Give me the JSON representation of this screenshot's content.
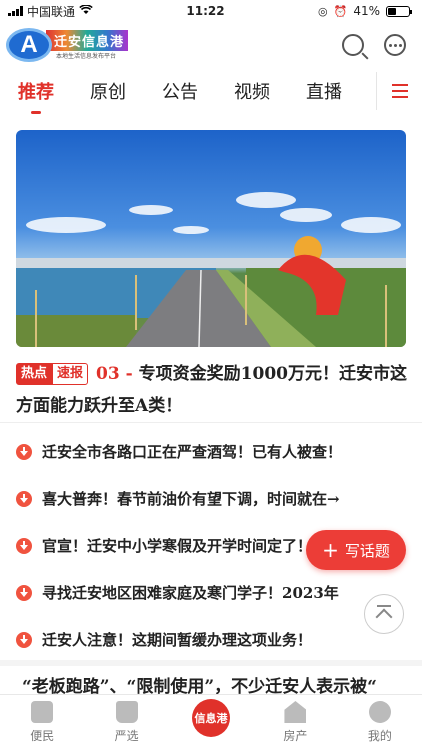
{
  "status_bar": {
    "carrier": "中国联通",
    "time": "11:22",
    "battery": "41%",
    "battery_level": 0.41
  },
  "header": {
    "logo_letter": "A",
    "logo_title": "迁安信息港",
    "logo_subtitle": "本地生活信息发布平台",
    "icons": [
      "search-icon",
      "chat-icon"
    ]
  },
  "tabs": [
    {
      "label": "推荐",
      "active": true
    },
    {
      "label": "原创",
      "active": false
    },
    {
      "label": "公告",
      "active": false
    },
    {
      "label": "视频",
      "active": false
    },
    {
      "label": "直播",
      "active": false
    }
  ],
  "headline": {
    "tag_hot": "热点",
    "tag_fast": "速报",
    "number": "03 -",
    "text": "专项资金奖励1000万元！迁安市这方面能力跃升至A类！"
  },
  "news": [
    "迁安全市各路口正在严查酒驾！已有人被查！",
    "喜大普奔！春节前油价有望下调，时间就在→",
    "官宣！迁安中小学寒假及开学时间定了！",
    "寻找迁安地区困难家庭及寒门学子！2023年",
    "迁安人注意！这期间暂缓办理这项业务！"
  ],
  "write_button": {
    "label": "写话题",
    "icon": "plus-icon"
  },
  "teaser": "“老板跑路”、“限制使用”，不少迁安人表示被“",
  "bottom_nav": {
    "items": [
      {
        "label": "便民",
        "icon": "convenience-icon"
      },
      {
        "label": "严选",
        "icon": "shopping-bag-icon"
      },
      {
        "label": "信息港",
        "icon": "home-center-icon"
      },
      {
        "label": "房产",
        "icon": "building-icon"
      },
      {
        "label": "我的",
        "icon": "avatar-icon"
      }
    ]
  },
  "colors": {
    "accent": "#e0312a",
    "write_button": "#ec3d37"
  }
}
